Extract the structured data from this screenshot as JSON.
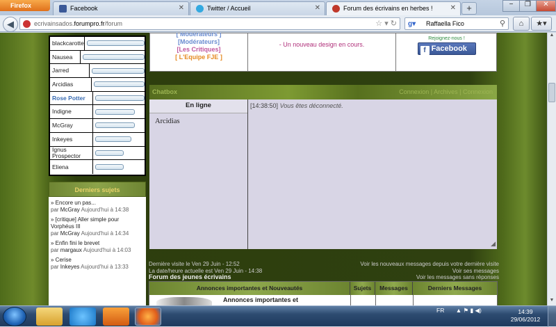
{
  "browser": {
    "app_button": "Firefox",
    "tabs": [
      {
        "label": "Facebook",
        "color": "#3b5998"
      },
      {
        "label": "Twitter / Accueil",
        "color": "#33a9e0"
      },
      {
        "label": "Forum des écrivains en herbes !",
        "color": "#c0392b",
        "active": true
      }
    ],
    "url_prefix": "ecrivainsados.",
    "url_domain": "forumpro.fr",
    "url_path": "/forum",
    "search_value": "Raffaella Fico",
    "window_controls": [
      "−",
      "❐",
      "✕"
    ]
  },
  "top_box": {
    "mods_partial": "[ Modérateurs ]",
    "mods": "[Modérateurs]",
    "critiques": "[Les Critiques]",
    "equipe": "[ L'Equipe FJE ]",
    "news": "- Un nouveau design en cours.",
    "join": "Rejoignez-nous !",
    "facebook": "Facebook"
  },
  "userbox": {
    "users": [
      {
        "name": "blackcarotte",
        "level": 0.95
      },
      {
        "name": "Nausea",
        "level": 0.95
      },
      {
        "name": "Jarred",
        "level": 0.62
      },
      {
        "name": "Arcidias",
        "level": 0.55
      },
      {
        "name": "Rose Potter",
        "level": 0.52,
        "highlight": true
      },
      {
        "name": "Indigne",
        "level": 0.42
      },
      {
        "name": "McGray",
        "level": 0.42
      },
      {
        "name": "Inkeyes",
        "level": 0.38
      },
      {
        "name": "Ignus Prospector",
        "level": 0.3
      },
      {
        "name": "Eliena",
        "level": 0.3
      }
    ]
  },
  "latest": {
    "title": "Derniers sujets",
    "topics": [
      {
        "title": "» Encore un pas...",
        "by": "par",
        "author": "McGray",
        "when": "Aujourd'hui à 14:38"
      },
      {
        "title": "» [critique] Aller simple pour Vorphéus III",
        "by": "par",
        "author": "McGray",
        "when": "Aujourd'hui à 14:34"
      },
      {
        "title": "» Enfin fini le brevet",
        "by": "par",
        "author": "margaux",
        "when": "Aujourd'hui à 14:03"
      },
      {
        "title": "» Cerise",
        "by": "par",
        "author": "Inkeyes",
        "when": "Aujourd'hui à 13:33"
      }
    ]
  },
  "chatbox": {
    "title": "Chatbox",
    "links": "Connexion | Archives | Connexion",
    "online_label": "En ligne",
    "member": "Arcidias",
    "time": "[14:38:50]",
    "message": "Vous êtes déconnecté."
  },
  "visit": {
    "last_visit": "Dernière visite le Ven 29 Juin - 12:52",
    "current": "La date/heure actuelle est Ven 29 Juin - 14:38",
    "new_msgs": "Voir les nouveaux messages depuis votre dernière visite",
    "my_msgs": "Voir ses messages",
    "unanswered": "Voir les messages sans réponses",
    "forum_name": "Forum des jeunes écrivains"
  },
  "forum_table": {
    "headers": [
      "Annonces importantes et Nouveautés",
      "Sujets",
      "Messages",
      "Derniers Messages"
    ],
    "row_title": "Annonces importantes et"
  },
  "taskbar": {
    "lang": "FR",
    "time": "14:39",
    "date": "29/06/2012"
  }
}
